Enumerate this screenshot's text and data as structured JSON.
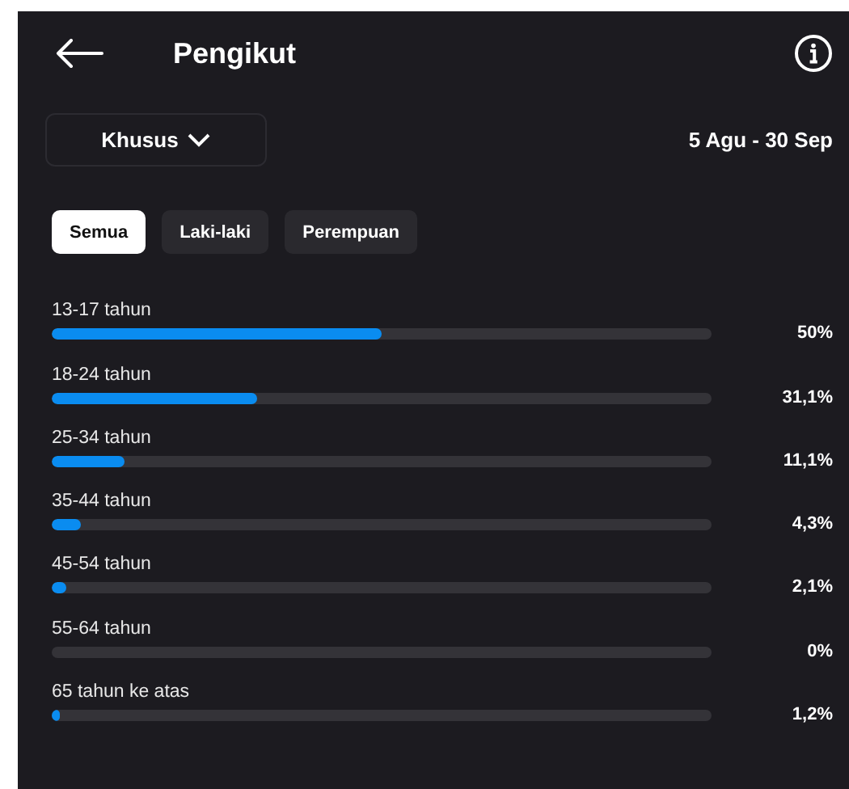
{
  "header": {
    "title": "Pengikut"
  },
  "filter": {
    "label": "Khusus",
    "date_range": "5 Agu - 30 Sep"
  },
  "tabs": [
    {
      "label": "Semua",
      "selected": true
    },
    {
      "label": "Laki-laki",
      "selected": false
    },
    {
      "label": "Perempuan",
      "selected": false
    }
  ],
  "age_groups": [
    {
      "label": "13-17 tahun",
      "level": 0.5,
      "reading": "50%"
    },
    {
      "label": "18-24 tahun",
      "level": 0.311,
      "reading": "31,1%"
    },
    {
      "label": "25-34 tahun",
      "level": 0.111,
      "reading": "11,1%"
    },
    {
      "label": "35-44 tahun",
      "level": 0.043,
      "reading": "4,3%"
    },
    {
      "label": "45-54 tahun",
      "level": 0.021,
      "reading": "2,1%"
    },
    {
      "label": "55-64 tahun",
      "reading": "0%"
    },
    {
      "label": "65 tahun ke atas",
      "level": 0.012,
      "reading": "1,2%"
    }
  ]
}
